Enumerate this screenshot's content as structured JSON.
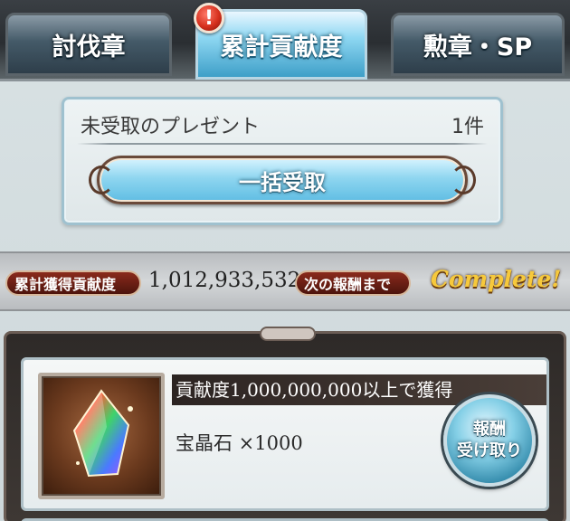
{
  "tabs": [
    {
      "label": "討伐章"
    },
    {
      "label": "累計貢献度",
      "active": true
    },
    {
      "label": "勲章・SP"
    }
  ],
  "alert_badge": "!",
  "present": {
    "label": "未受取のプレゼント",
    "count": "1件",
    "receive_all_label": "一括受取"
  },
  "stats": {
    "total_label": "累計獲得貢献度",
    "total_value": "1,012,933,532",
    "next_label": "次の報酬まで",
    "next_value": "Complete!"
  },
  "reward": {
    "condition": "貢献度1,000,000,000以上で獲得",
    "item": "宝晶石 ×1000",
    "item_icon": "rainbow-crystal-icon",
    "claim_line1": "報酬",
    "claim_line2": "受け取り"
  },
  "colors": {
    "accent_blue": "#5fbde3",
    "pill_red": "#8a2a1c",
    "complete_gold": "#f6c93c"
  }
}
